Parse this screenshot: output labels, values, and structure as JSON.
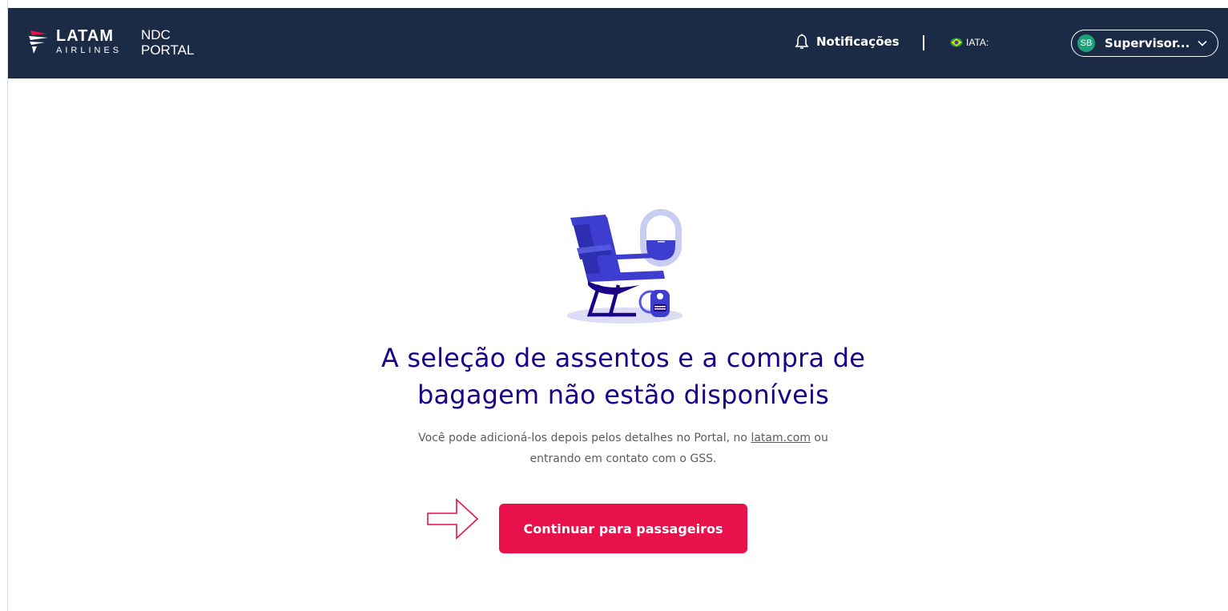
{
  "header": {
    "brand_name": "LATAM",
    "brand_sub": "AIRLINES",
    "portal_line1": "NDC",
    "portal_line2": "PORTAL",
    "notifications_label": "Notificações",
    "iata_label": "IATA:",
    "user_initials": "SB",
    "user_name": "Supervisor..."
  },
  "main": {
    "title_line1": "A seleção de assentos e a compra de",
    "title_line2": "bagagem não estão disponíveis",
    "subtitle_part1": "Você pode adicioná-los depois pelos detalhes no Portal, no ",
    "subtitle_link": "latam.com",
    "subtitle_part2": " ou",
    "subtitle_line2": "entrando em contato com o GSS.",
    "continue_button": "Continuar para passageiros"
  },
  "colors": {
    "header_bg": "#1b2a45",
    "title_color": "#1b0088",
    "cta_bg": "#e8114b",
    "avatar_bg": "#1aa37a"
  },
  "icons": {
    "logo": "latam-logo-icon",
    "notifications": "bell-icon",
    "flag": "brazil-flag-icon",
    "dropdown": "chevron-down-icon",
    "illustration": "airplane-seat-illustration",
    "pointer": "arrow-right-icon"
  }
}
